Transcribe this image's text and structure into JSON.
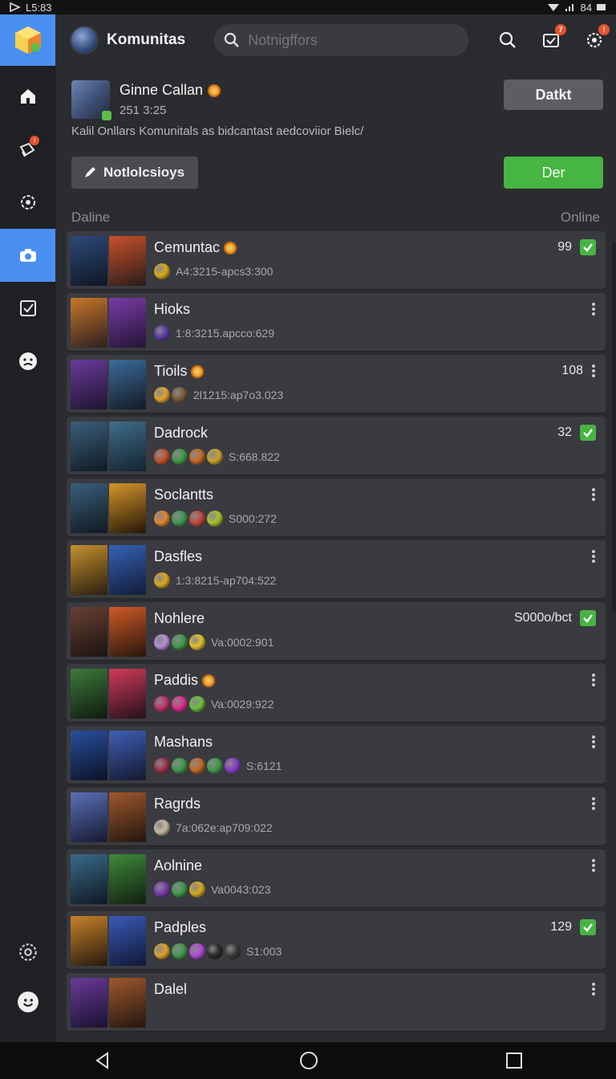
{
  "status": {
    "time": "L5:83",
    "battery": "84"
  },
  "app": {
    "title": "Komunitas"
  },
  "search": {
    "placeholder": "Notnigffors"
  },
  "topbar": {
    "notif_badge": "7",
    "settings_badge": "!"
  },
  "sidebar": {
    "notif_badge": "!"
  },
  "profile": {
    "name": "Ginne Callan",
    "time": "251 3:25",
    "description": "Kalil Onllars Komunitals as bidcantast aedcoviior Bielc/",
    "action_label": "Datkt"
  },
  "actions": {
    "notif_label": "Notlolcsioys",
    "primary_label": "Der"
  },
  "section": {
    "left_label": "Daline",
    "right_label": "Online"
  },
  "rows": [
    {
      "name": "Cemuntac",
      "meta": "A4:3215-apcs3:300",
      "count": "99",
      "trailing": "check",
      "gold": true,
      "thumbs": [
        "#2d4a7a,#0f1624",
        "#c8502a,#2a1c1a"
      ],
      "dots": [
        "#d8a81b"
      ]
    },
    {
      "name": "Hioks",
      "meta": "1:8:3215.apcco:629",
      "count": "",
      "trailing": "menu",
      "gold": false,
      "thumbs": [
        "#c7772b,#2c2020",
        "#7a3aa8,#231634"
      ],
      "dots": [
        "#5a3aa0"
      ]
    },
    {
      "name": "Tioils",
      "meta": "2l1215:ap7o3.023",
      "count": "108",
      "trailing": "menu",
      "gold": true,
      "thumbs": [
        "#6b3a9a,#1e1530",
        "#3c6c9a,#121a26"
      ],
      "dots": [
        "#e2a12a",
        "#7a5a3a"
      ]
    },
    {
      "name": "Dadrock",
      "meta": "S:668.822",
      "count": "32",
      "trailing": "check",
      "gold": false,
      "thumbs": [
        "#3b5f7c,#101a24",
        "#3f6e8a,#142230"
      ],
      "dots": [
        "#c0502a",
        "#3f9a4a",
        "#c46a20",
        "#caa22c"
      ]
    },
    {
      "name": "Soclantts",
      "meta": "S000:272",
      "count": "",
      "trailing": "menu",
      "gold": false,
      "thumbs": [
        "#3a5f7c,#101820",
        "#d6952a,#251708"
      ],
      "dots": [
        "#e0862a",
        "#3e9a4a",
        "#c0483a",
        "#a9c12c"
      ]
    },
    {
      "name": "Dasfles",
      "meta": "1:3:8215-ap704:522",
      "count": "",
      "trailing": "menu",
      "gold": false,
      "thumbs": [
        "#c4902e,#2a1e10",
        "#3562b8,#111c36"
      ],
      "dots": [
        "#d8a81b"
      ]
    },
    {
      "name": "Nohlere",
      "meta": "Va:0002:901",
      "count": "S000o/bct",
      "trailing": "check",
      "gold": false,
      "thumbs": [
        "#6a4032,#1a1312",
        "#d05a26,#28160e"
      ],
      "dots": [
        "#b98ad6",
        "#3e9a4a",
        "#e4c02a"
      ]
    },
    {
      "name": "Paddis",
      "meta": "Va:0029:922",
      "count": "",
      "trailing": "menu",
      "gold": true,
      "thumbs": [
        "#3d7a3a,#0f1a10",
        "#d23a5a,#24101a"
      ],
      "dots": [
        "#c0306a",
        "#e02a8a",
        "#6ac03a"
      ]
    },
    {
      "name": "Mashans",
      "meta": "S:6121",
      "count": "",
      "trailing": "menu",
      "gold": false,
      "thumbs": [
        "#2a4fa0,#0c1226",
        "#3f5fb8,#14182e"
      ],
      "dots": [
        "#a0304a",
        "#3e9a4a",
        "#c46a20",
        "#3e9a4a",
        "#8a3aca"
      ]
    },
    {
      "name": "Ragrds",
      "meta": "7a:062e:ap709:022",
      "count": "",
      "trailing": "menu",
      "gold": false,
      "thumbs": [
        "#5a6fb8,#161a30",
        "#a0582e,#22160e"
      ],
      "dots": [
        "#c6b9a0"
      ]
    },
    {
      "name": "Aolnine",
      "meta": "Va0043:023",
      "count": "",
      "trailing": "menu",
      "gold": false,
      "thumbs": [
        "#3a6a8a,#0f1822",
        "#3e8a3a,#12200e"
      ],
      "dots": [
        "#7a3ab0",
        "#3e9a4a",
        "#d8a81b"
      ]
    },
    {
      "name": "Padples",
      "meta": "S1:003",
      "count": "129",
      "trailing": "check",
      "gold": false,
      "thumbs": [
        "#c9822a,#241a0e",
        "#3a5ab8,#101836"
      ],
      "dots": [
        "#e0a02a",
        "#3e9a4a",
        "#b04ad6",
        "#2a2a2a",
        "#3a3a3a"
      ]
    },
    {
      "name": "Dalel",
      "meta": "",
      "count": "",
      "trailing": "menu",
      "gold": false,
      "thumbs": [
        "#6b3a9a,#1a1230",
        "#a0582e,#22160e"
      ],
      "dots": []
    }
  ]
}
